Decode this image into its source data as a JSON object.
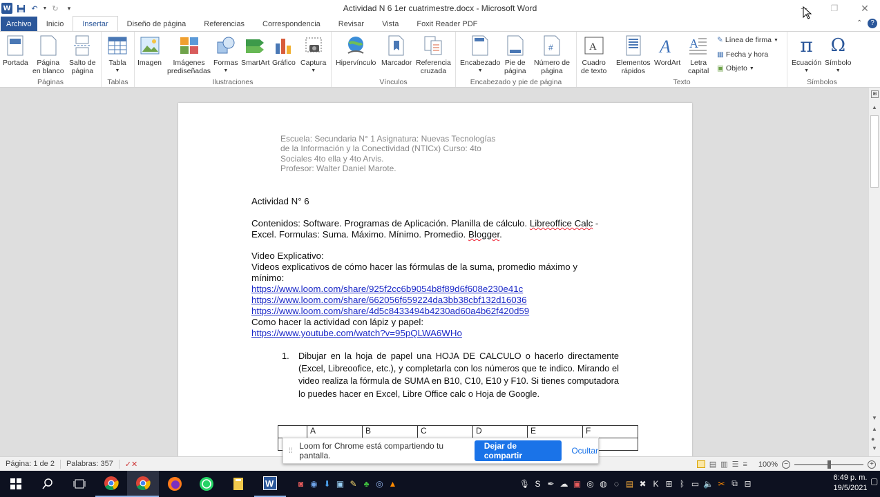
{
  "app": {
    "title": "Actividad N 6 1er cuatrimestre.docx - Microsoft Word"
  },
  "tabs": [
    "Archivo",
    "Inicio",
    "Insertar",
    "Diseño de página",
    "Referencias",
    "Correspondencia",
    "Revisar",
    "Vista",
    "Foxit Reader PDF"
  ],
  "active_tab": "Insertar",
  "ribbon": {
    "groups": [
      {
        "label": "Páginas",
        "buttons": [
          "Portada",
          "Página\nen blanco",
          "Salto de\npágina"
        ]
      },
      {
        "label": "Tablas",
        "buttons": [
          "Tabla"
        ]
      },
      {
        "label": "Ilustraciones",
        "buttons": [
          "Imagen",
          "Imágenes\nprediseñadas",
          "Formas",
          "SmartArt",
          "Gráfico",
          "Captura"
        ]
      },
      {
        "label": "Vínculos",
        "buttons": [
          "Hipervínculo",
          "Marcador",
          "Referencia\ncruzada"
        ]
      },
      {
        "label": "Encabezado y pie de página",
        "buttons": [
          "Encabezado",
          "Pie de\npágina",
          "Número de\npágina"
        ]
      },
      {
        "label": "Texto",
        "buttons": [
          "Cuadro\nde texto",
          "Elementos\nrápidos",
          "WordArt",
          "Letra\ncapital"
        ]
      },
      {
        "label": "Símbolos",
        "buttons": [
          "Ecuación",
          "Símbolo"
        ]
      }
    ],
    "small_buttons": [
      "Línea de firma",
      "Fecha y hora",
      "Objeto"
    ]
  },
  "document": {
    "header_lines": [
      "Escuela: Secundaria N° 1 Asignatura: Nuevas Tecnologías",
      "de la Información y la Conectividad (NTICx)  Curso: 4to",
      "Sociales 4to ella y 4to Arvis.",
      "Profesor: Walter Daniel Marote."
    ],
    "title": "Actividad N° 6",
    "contenidos_1": "Contenidos: Software. Programas de Aplicación. Planilla de cálculo. ",
    "contenidos_2": "Libreoffice Calc",
    "contenidos_3": " -",
    "contenidos_4": "Excel. Formulas: Suma. Máximo. Mínimo. Promedio. ",
    "contenidos_5": "Blogger",
    "contenidos_6": ".",
    "video_label": "Video Explicativo:",
    "video_desc": "Videos explicativos de cómo hacer las fórmulas de la suma, promedio máximo y mínimo:",
    "links": [
      "https://www.loom.com/share/925f2cc6b9054b8f89d6f608e230e41c",
      "https://www.loom.com/share/662056f659224da3bb38cbf132d16036",
      "https://www.loom.com/share/4d5c8433494b4230ad60a4b62f420d59"
    ],
    "paper_label": "Como hacer la actividad con lápiz y papel:",
    "youtube": "https://www.youtube.com/watch?v=95pQLWA6WHo",
    "item_num": "1.",
    "item_text": "Dibujar en la hoja de papel una HOJA DE CALCULO o hacerlo directamente (Excel, Libreoofice, etc.), y completarla con los números que te indico. Mirando el video realiza la fórmula de SUMA en B10, C10, E10 y F10. Si tienes computadora lo puedes hacer en Excel, Libre Office calc o Hoja de Google.",
    "table_headers": [
      "",
      "A",
      "B",
      "C",
      "D",
      "E",
      "F"
    ]
  },
  "share_bar": {
    "message": "Loom for Chrome está compartiendo tu pantalla.",
    "stop": "Dejar de compartir",
    "hide": "Ocultar"
  },
  "status": {
    "page": "Página: 1 de 2",
    "words": "Palabras: 357",
    "zoom": "100%"
  },
  "clock": {
    "time": "6:49 p. m.",
    "date": "19/5/2021"
  }
}
